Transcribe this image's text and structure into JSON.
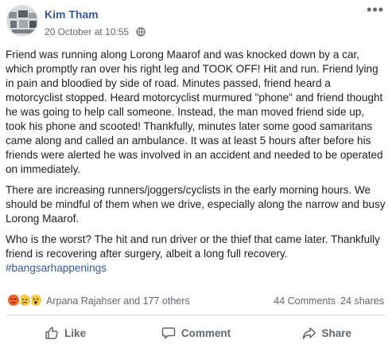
{
  "post": {
    "author": "Kim Tham",
    "timestamp": "20 October at 10:55",
    "privacy_icon": "globe-icon",
    "more_icon": "more-options-icon",
    "paragraphs": [
      "Friend was running along Lorong Maarof and was knocked down by a car, which promptly ran over his right leg and TOOK OFF! Hit and run. Friend lying in pain and bloodied by side of road. Minutes passed, friend heard a motorcyclist stopped. Heard motorcyclist murmured \"phone\" and friend thought he was going to help call someone. Instead, the man moved friend side up, took his phone and scooted! Thankfully, minutes later some good samaritans came along and called an ambulance. It was at least 5 hours after before his friends were alerted he was involved in an accident and needed to be operated on immediately.",
      "There are increasing runners/joggers/cyclists in the early morning hours. We should be mindful of them when we drive, especially along the narrow and busy Lorong Maarof.",
      "Who is the worst? The hit and run driver or the thief that came later. Thankfully friend is recovering after surgery, albeit a long full recovery."
    ],
    "hashtag": "#bangsarhappenings"
  },
  "reactions": {
    "icons": [
      "angry-icon",
      "sad-icon",
      "wow-icon"
    ],
    "reacted_by": "Arpana Rajahser and 177 others",
    "comments": "44 Comments",
    "shares": "24 shares"
  },
  "actions": {
    "like": "Like",
    "comment": "Comment",
    "share": "Share"
  },
  "colors": {
    "link": "#385898",
    "text": "#1c1e21",
    "muted": "#606770"
  }
}
